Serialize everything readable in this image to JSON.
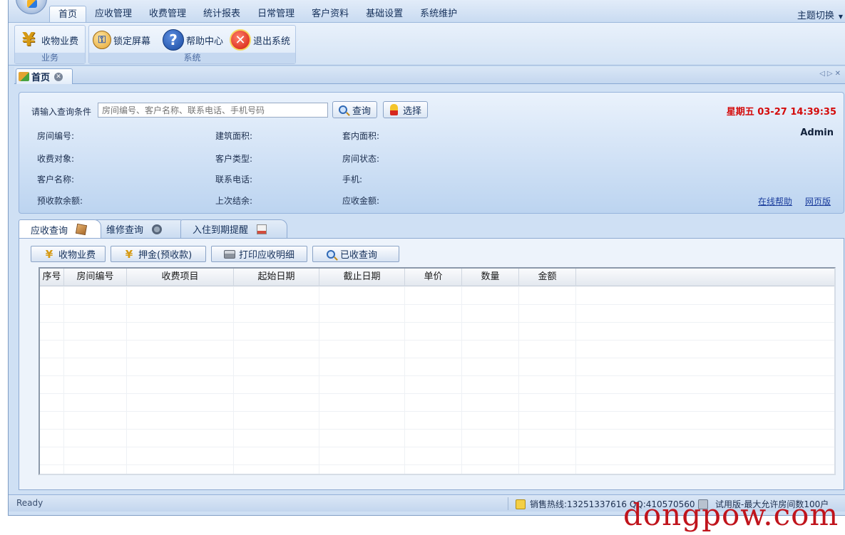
{
  "menu": {
    "tabs": [
      "首页",
      "应收管理",
      "收费管理",
      "统计报表",
      "日常管理",
      "客户资料",
      "基础设置",
      "系统维护"
    ],
    "active_tab": "首页",
    "theme_switch": "主题切换"
  },
  "ribbon": {
    "groups": [
      {
        "label": "业务",
        "buttons": [
          {
            "label": "收物业费",
            "icon": "yen-icon"
          }
        ]
      },
      {
        "label": "系统",
        "buttons": [
          {
            "label": "锁定屏幕",
            "icon": "lock-screen-icon"
          },
          {
            "label": "帮助中心",
            "icon": "help-icon"
          },
          {
            "label": "退出系统",
            "icon": "exit-icon"
          }
        ]
      }
    ]
  },
  "doc_tab": {
    "label": "首页"
  },
  "query": {
    "prompt_label": "请输入查询条件",
    "input_placeholder": "房间编号、客户名称、联系电话、手机号码",
    "search_button": "查询",
    "select_button": "选择",
    "datetime": "星期五 03-27 14:39:35",
    "user": "Admin",
    "fields": {
      "room_no": "房间编号:",
      "building_area": "建筑面积:",
      "inner_area": "套内面积:",
      "charge_target": "收费对象:",
      "customer_type": "客户类型:",
      "room_status": "房间状态:",
      "customer_name": "客户名称:",
      "contact_phone": "联系电话:",
      "mobile": "手机:",
      "prepaid_balance": "预收款余额:",
      "last_settlement": "上次结余:",
      "receivable_amount": "应收金额:"
    },
    "links": {
      "online_help": "在线帮助",
      "web_version": "网页版"
    }
  },
  "inner_tabs": [
    {
      "label": "应收查询",
      "icon": "package-icon"
    },
    {
      "label": "维修查询",
      "icon": "tools-icon"
    },
    {
      "label": "入住到期提醒",
      "icon": "calendar-icon"
    }
  ],
  "actions": {
    "collect_fee": "收物业费",
    "deposit": "押金(预收款)",
    "print_details": "打印应收明细",
    "received_query": "已收查询"
  },
  "table": {
    "columns": [
      "序号",
      "房间编号",
      "收费项目",
      "起始日期",
      "截止日期",
      "单价",
      "数量",
      "金额"
    ],
    "rows": []
  },
  "status": {
    "ready": "Ready",
    "hotline": "销售热线:13251337616 QQ:410570560",
    "trial": "试用版-最大允许房间数100户"
  },
  "watermark": "dongpow.com"
}
